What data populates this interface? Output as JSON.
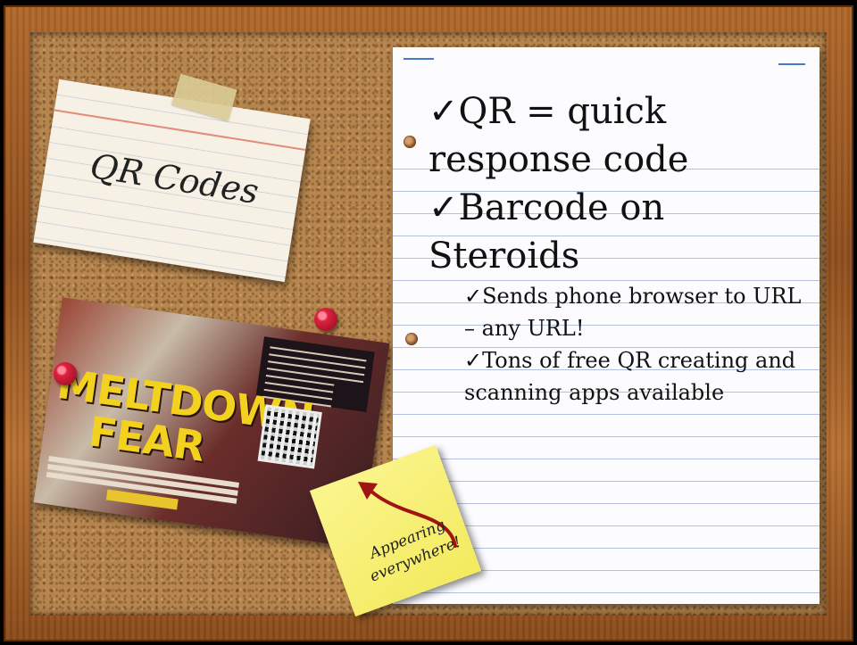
{
  "card": {
    "title": "QR Codes"
  },
  "clipping": {
    "headline_line1": "MELTDOWN",
    "headline_line2": "FEAR"
  },
  "sticky": {
    "line1": "Appearing",
    "line2": "everywhere!"
  },
  "notebook": {
    "check_mark": "✓",
    "bullets": [
      {
        "level": 1,
        "text": "QR = quick response code"
      },
      {
        "level": 1,
        "text": "Barcode on Steroids"
      },
      {
        "level": 2,
        "text": "Sends phone browser to URL – any URL!"
      },
      {
        "level": 2,
        "text": "Tons of free QR creating and scanning apps available"
      }
    ]
  },
  "colors": {
    "pin_red": "#e0223f",
    "sticky_yellow": "#f3ea5e",
    "arrow_red": "#a11414",
    "rule_blue": "#b5bfe0",
    "headline_yellow": "#f2d21e"
  }
}
